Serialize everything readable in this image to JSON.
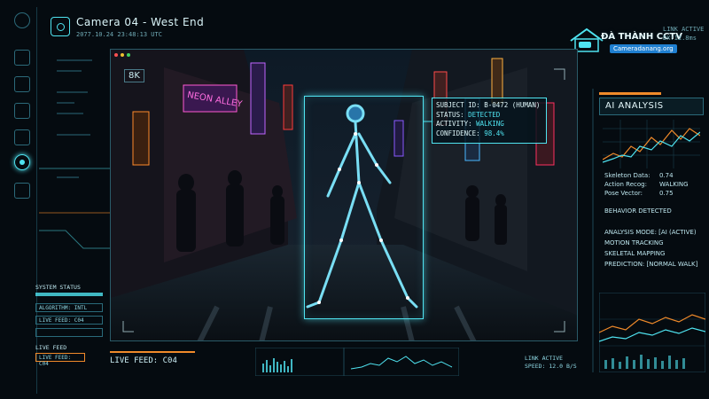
{
  "header": {
    "title": "Camera 04 - West End",
    "timestamp": "2077.10.24 23:48:13 UTC"
  },
  "brand": {
    "name": "ĐÀ THÀNH CCTV",
    "site": "Cameradanang.org"
  },
  "link_top": [
    "LINK ACTIVE",
    "DX:12.8ms"
  ],
  "video": {
    "resolution": "8K"
  },
  "detection": {
    "subject_label": "SUBJECT ID:",
    "subject_value": "B-0472 (HUMAN)",
    "status_label": "STATUS:",
    "status_value": "DETECTED",
    "activity_label": "ACTIVITY:",
    "activity_value": "WALKING",
    "confidence_label": "CONFIDENCE:",
    "confidence_value": "98.4%"
  },
  "ai_panel": {
    "title": "AI ANALYSIS",
    "rows": [
      {
        "label": "Skeleton Data:",
        "value": "0.74"
      },
      {
        "label": "Action Recog:",
        "value": "WALKING"
      },
      {
        "label": "Pose Vector:",
        "value": "0.75"
      }
    ],
    "behavior": "BEHAVIOR DETECTED",
    "mode_lines": [
      "ANALYSIS MODE: [AI (ACTIVE)",
      "MOTION TRACKING",
      "SKELETAL MAPPING",
      "PREDICTION: [NORMAL WALK]"
    ]
  },
  "system_status": {
    "title": "SYSTEM STATUS",
    "items": [
      "ALGORITHM: INTL",
      "LIVE FEED: C04"
    ]
  },
  "live_feed": {
    "title": "LIVE FEED",
    "item": "LIVE FEED: C04"
  },
  "bottom": {
    "live_feed_label": "LIVE FEED: C04",
    "link_status": "LINK ACTIVE",
    "speed": "SPEED: 12.0 B/S"
  },
  "colors": {
    "accent": "#4fe3f0",
    "warning": "#f08a2a",
    "panel_border": "#2a6a7a"
  }
}
